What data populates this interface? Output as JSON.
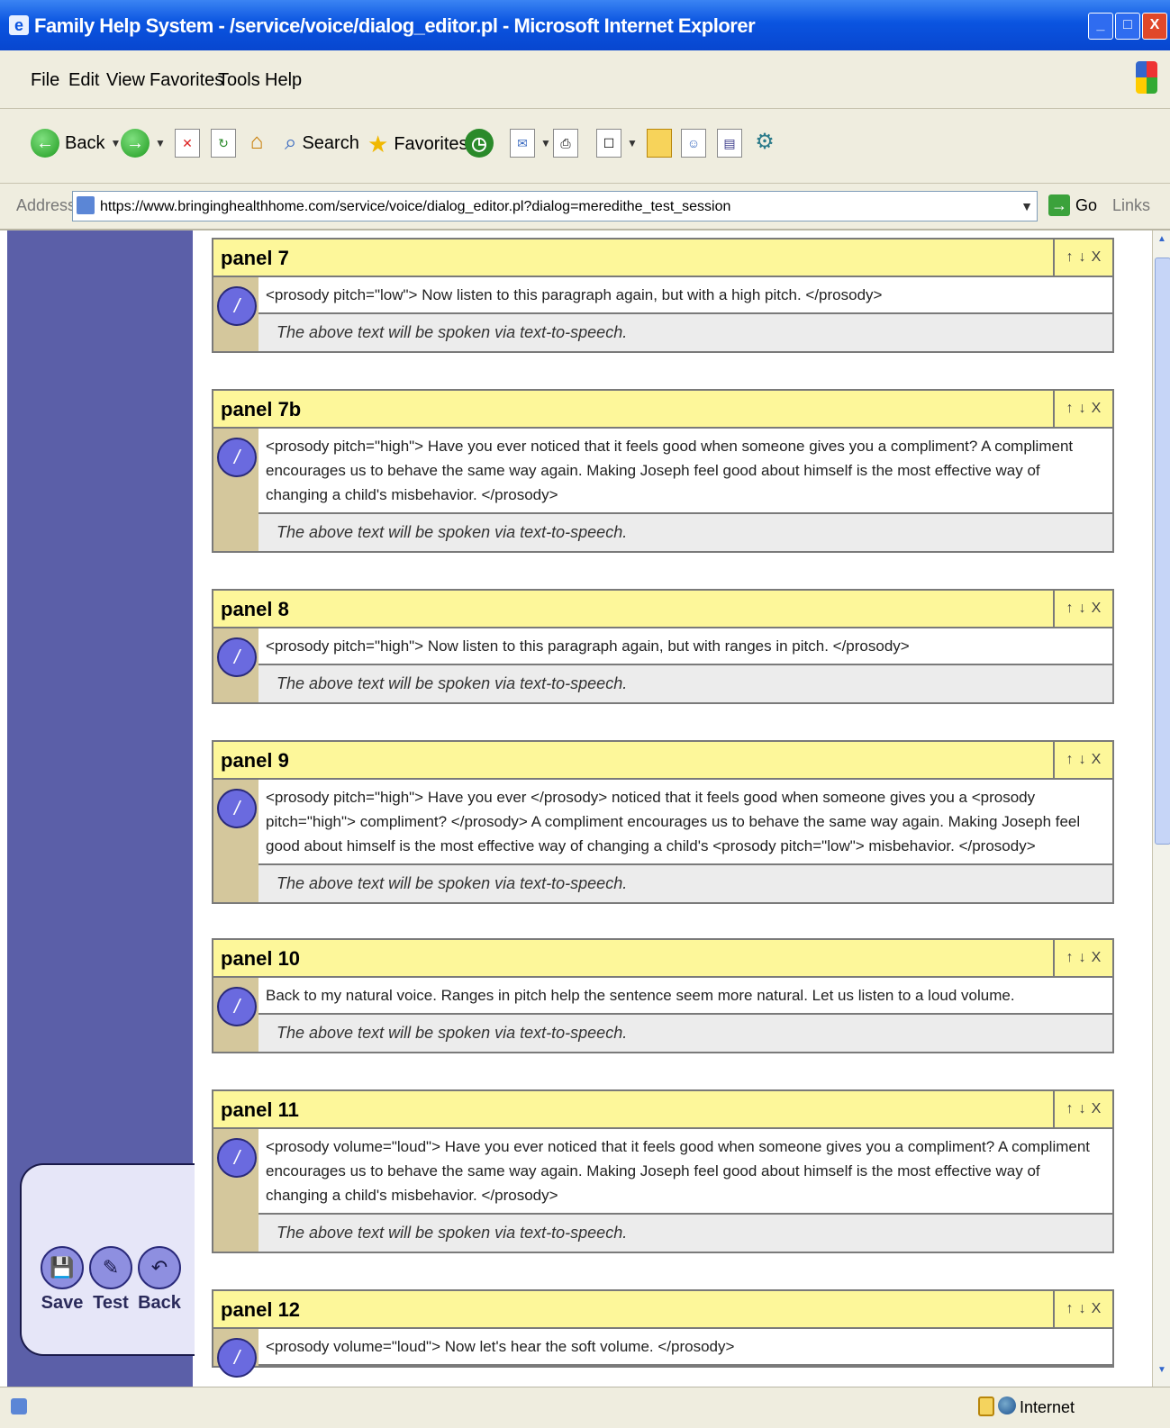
{
  "window": {
    "title": "Family Help System - /service/voice/dialog_editor.pl - Microsoft Internet Explorer",
    "controls": {
      "minimize": "_",
      "maximize": "□",
      "close": "X"
    }
  },
  "menu": [
    "File",
    "Edit",
    "View",
    "Favorites",
    "Tools",
    "Help"
  ],
  "toolbar": {
    "back_label": "Back",
    "search_label": "Search",
    "favorites_label": "Favorites"
  },
  "address": {
    "label": "Address",
    "url": "https://www.bringinghealthhome.com/service/voice/dialog_editor.pl?dialog=meredithe_test_session",
    "go_label": "Go",
    "links_label": "Links"
  },
  "panels": [
    {
      "title": "panel 7",
      "text": "<prosody pitch=\"low\"> Now listen to this paragraph again, but with a high pitch. </prosody>",
      "note": "The above text will be spoken via text-to-speech."
    },
    {
      "title": "panel 7b",
      "text": "<prosody pitch=\"high\"> Have you ever noticed that it feels good when someone gives you a compliment? A compliment encourages us to behave the same way again. Making Joseph feel good about himself is the most effective way of changing a child's misbehavior. </prosody>",
      "note": "The above text will be spoken via text-to-speech."
    },
    {
      "title": "panel 8",
      "text": "<prosody pitch=\"high\"> Now listen to this paragraph again, but with ranges in pitch. </prosody>",
      "note": "The above text will be spoken via text-to-speech."
    },
    {
      "title": "panel 9",
      "text": "<prosody pitch=\"high\"> Have you ever </prosody> noticed that it feels good when someone gives you a <prosody pitch=\"high\"> compliment? </prosody> A compliment encourages us to behave the same way again. Making Joseph feel good about himself is the most effective way of changing a child's <prosody pitch=\"low\"> misbehavior. </prosody>",
      "note": "The above text will be spoken via text-to-speech."
    },
    {
      "title": "panel 10",
      "text": "Back to my natural voice. Ranges in pitch help the sentence seem more natural. Let us listen to a loud volume.",
      "note": "The above text will be spoken via text-to-speech."
    },
    {
      "title": "panel 11",
      "text": "<prosody volume=\"loud\"> Have you ever noticed that it feels good when someone gives you a compliment? A compliment encourages us to behave the same way again. Making Joseph feel good about himself is the most effective way of changing a child's misbehavior. </prosody>",
      "note": "The above text will be spoken via text-to-speech."
    },
    {
      "title": "panel 12",
      "text": "<prosody volume=\"loud\"> Now let's hear the soft volume. </prosody>",
      "note": ""
    }
  ],
  "panel_controls": {
    "up": "↑",
    "down": "↓",
    "remove": "X"
  },
  "actions": {
    "save": "Save",
    "test": "Test",
    "back": "Back"
  },
  "status": {
    "zone": "Internet"
  }
}
